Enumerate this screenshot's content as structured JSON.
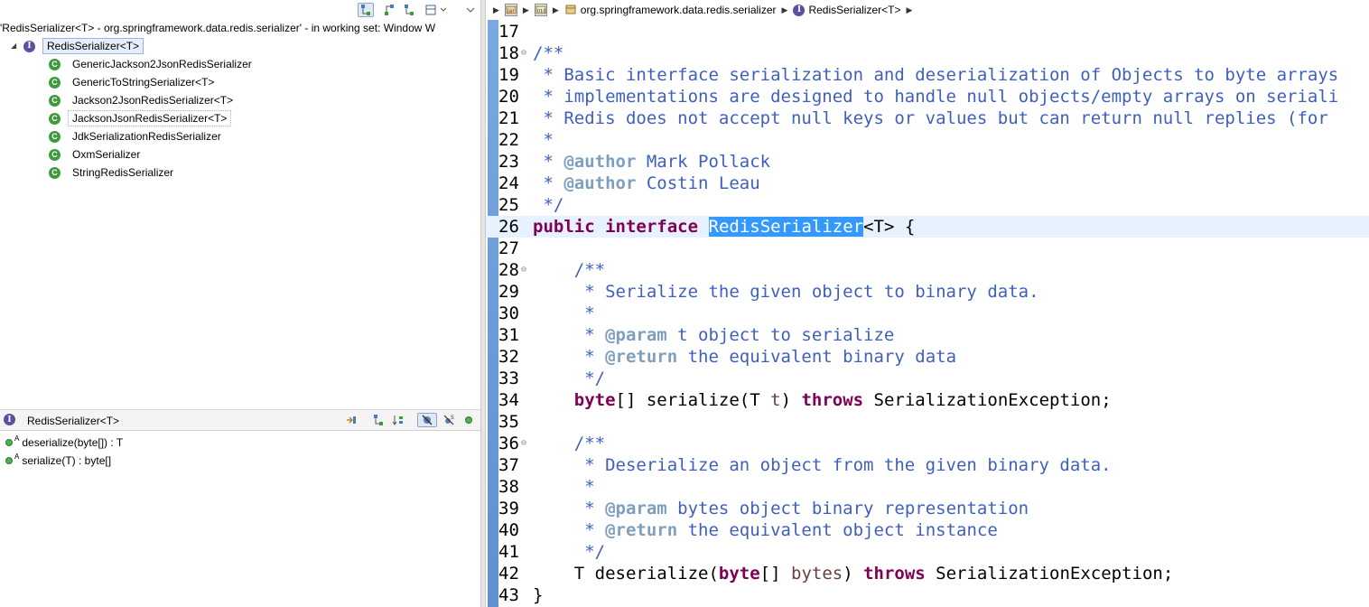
{
  "hierarchy": {
    "status": "'RedisSerializer<T> - org.springframework.data.redis.serializer' - in working set: Window W",
    "root": {
      "label": "RedisSerializer<T>",
      "icon": "interface-icon"
    },
    "children": [
      {
        "label": "GenericJackson2JsonRedisSerializer",
        "icon": "class-icon"
      },
      {
        "label": "GenericToStringSerializer<T>",
        "icon": "class-icon"
      },
      {
        "label": "Jackson2JsonRedisSerializer<T>",
        "icon": "class-icon"
      },
      {
        "label": "JacksonJsonRedisSerializer<T>",
        "icon": "class-icon"
      },
      {
        "label": "JdkSerializationRedisSerializer",
        "icon": "class-icon"
      },
      {
        "label": "OxmSerializer",
        "icon": "class-icon"
      },
      {
        "label": "StringRedisSerializer",
        "icon": "class-icon"
      }
    ],
    "toolbar": {
      "show_type_hierarchy": "type-hierarchy-icon",
      "show_supertype": "supertype-icon",
      "show_subtype": "subtype-icon",
      "layout": "layout-icon",
      "menu": "view-menu-icon"
    }
  },
  "members": {
    "title": "RedisSerializer<T>",
    "abstract_marker": "A",
    "items": [
      {
        "label": "deserialize(byte[]) : T"
      },
      {
        "label": "serialize(T) : byte[]"
      }
    ]
  },
  "breadcrumb": {
    "items": [
      {
        "label": "",
        "icon": "jar-icon"
      },
      {
        "label": "",
        "icon": "package-root-icon"
      },
      {
        "label": "org.springframework.data.redis.serializer",
        "icon": "package-icon"
      },
      {
        "label": "RedisSerializer<T>",
        "icon": "interface-icon"
      }
    ]
  },
  "editor": {
    "lines": [
      {
        "n": "17",
        "parts": []
      },
      {
        "n": "18",
        "fold": "⊖",
        "parts": [
          {
            "cls": "c",
            "t": "/**"
          }
        ]
      },
      {
        "n": "19",
        "parts": [
          {
            "cls": "c",
            "t": " * Basic interface serialization and deserialization of Objects to byte arrays"
          }
        ]
      },
      {
        "n": "20",
        "parts": [
          {
            "cls": "c",
            "t": " * implementations are designed to handle null objects/empty arrays on seriali"
          }
        ]
      },
      {
        "n": "21",
        "parts": [
          {
            "cls": "c",
            "t": " * Redis does not accept null keys or values but can return null replies (for"
          }
        ]
      },
      {
        "n": "22",
        "parts": [
          {
            "cls": "c",
            "t": " *"
          }
        ]
      },
      {
        "n": "23",
        "parts": [
          {
            "cls": "c",
            "t": " * "
          },
          {
            "cls": "tag",
            "t": "@author"
          },
          {
            "cls": "c",
            "t": " Mark Pollack"
          }
        ]
      },
      {
        "n": "24",
        "parts": [
          {
            "cls": "c",
            "t": " * "
          },
          {
            "cls": "tag",
            "t": "@author"
          },
          {
            "cls": "c",
            "t": " Costin Leau"
          }
        ]
      },
      {
        "n": "25",
        "parts": [
          {
            "cls": "c",
            "t": " */"
          }
        ]
      },
      {
        "n": "26",
        "current": true,
        "parts": [
          {
            "cls": "kw",
            "t": "public"
          },
          {
            "cls": "",
            "t": " "
          },
          {
            "cls": "kw",
            "t": "interface"
          },
          {
            "cls": "",
            "t": " "
          },
          {
            "cls": "hl",
            "t": "RedisSerializer"
          },
          {
            "cls": "",
            "t": "<T> {"
          }
        ]
      },
      {
        "n": "27",
        "parts": []
      },
      {
        "n": "28",
        "fold": "⊖",
        "parts": [
          {
            "cls": "c",
            "t": "    /**"
          }
        ]
      },
      {
        "n": "29",
        "parts": [
          {
            "cls": "c",
            "t": "     * Serialize the given object to binary data."
          }
        ]
      },
      {
        "n": "30",
        "parts": [
          {
            "cls": "c",
            "t": "     *"
          }
        ]
      },
      {
        "n": "31",
        "parts": [
          {
            "cls": "c",
            "t": "     * "
          },
          {
            "cls": "tag",
            "t": "@param"
          },
          {
            "cls": "c",
            "t": " t object to serialize"
          }
        ]
      },
      {
        "n": "32",
        "parts": [
          {
            "cls": "c",
            "t": "     * "
          },
          {
            "cls": "tag",
            "t": "@return"
          },
          {
            "cls": "c",
            "t": " the equivalent binary data"
          }
        ]
      },
      {
        "n": "33",
        "parts": [
          {
            "cls": "c",
            "t": "     */"
          }
        ]
      },
      {
        "n": "34",
        "parts": [
          {
            "cls": "",
            "t": "    "
          },
          {
            "cls": "kw",
            "t": "byte"
          },
          {
            "cls": "",
            "t": "[] serialize(T "
          },
          {
            "cls": "pn",
            "t": "t"
          },
          {
            "cls": "",
            "t": ") "
          },
          {
            "cls": "kw",
            "t": "throws"
          },
          {
            "cls": "",
            "t": " SerializationException;"
          }
        ]
      },
      {
        "n": "35",
        "parts": []
      },
      {
        "n": "36",
        "fold": "⊖",
        "parts": [
          {
            "cls": "c",
            "t": "    /**"
          }
        ]
      },
      {
        "n": "37",
        "parts": [
          {
            "cls": "c",
            "t": "     * Deserialize an object from the given binary data."
          }
        ]
      },
      {
        "n": "38",
        "parts": [
          {
            "cls": "c",
            "t": "     *"
          }
        ]
      },
      {
        "n": "39",
        "parts": [
          {
            "cls": "c",
            "t": "     * "
          },
          {
            "cls": "tag",
            "t": "@param"
          },
          {
            "cls": "c",
            "t": " bytes object binary representation"
          }
        ]
      },
      {
        "n": "40",
        "parts": [
          {
            "cls": "c",
            "t": "     * "
          },
          {
            "cls": "tag",
            "t": "@return"
          },
          {
            "cls": "c",
            "t": " the equivalent object instance"
          }
        ]
      },
      {
        "n": "41",
        "parts": [
          {
            "cls": "c",
            "t": "     */"
          }
        ]
      },
      {
        "n": "42",
        "parts": [
          {
            "cls": "",
            "t": "    T deserialize("
          },
          {
            "cls": "kw",
            "t": "byte"
          },
          {
            "cls": "",
            "t": "[] "
          },
          {
            "cls": "pn",
            "t": "bytes"
          },
          {
            "cls": "",
            "t": ") "
          },
          {
            "cls": "kw",
            "t": "throws"
          },
          {
            "cls": "",
            "t": " SerializationException;"
          }
        ]
      },
      {
        "n": "43",
        "parts": [
          {
            "cls": "",
            "t": "}"
          }
        ]
      }
    ]
  }
}
